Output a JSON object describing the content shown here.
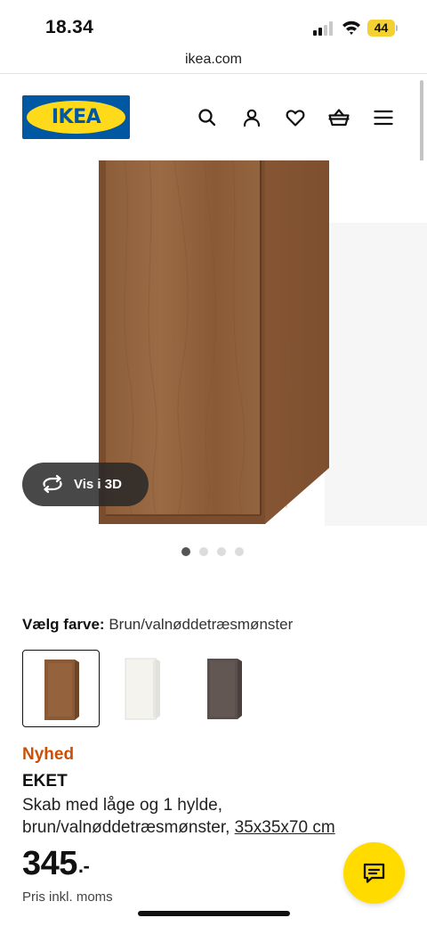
{
  "status_bar": {
    "time": "18.34",
    "battery_level": "44",
    "icons": [
      "signal-icon",
      "wifi-icon",
      "battery-icon"
    ]
  },
  "browser": {
    "url": "ikea.com"
  },
  "header": {
    "logo_text": "IKEA",
    "icons": [
      "search-icon",
      "account-icon",
      "heart-icon",
      "basket-icon",
      "menu-icon"
    ]
  },
  "gallery": {
    "view_3d_label": "Vis i 3D",
    "slide_count": 4,
    "active_slide": 1
  },
  "color_picker": {
    "label": "Vælg farve:",
    "selected_value": "Brun/valnøddetræsmønster",
    "options": [
      {
        "name": "brown-walnut",
        "color": "#8a5a36",
        "selected": true
      },
      {
        "name": "white",
        "color": "#f4f3ee",
        "selected": false
      },
      {
        "name": "dark-grey",
        "color": "#5a4f4c",
        "selected": false
      }
    ]
  },
  "product": {
    "badge": "Nyhed",
    "name": "EKET",
    "description": "Skab med låge og 1 hylde, brun/valnøddetræsmønster,",
    "dimensions": "35x35x70 cm",
    "price": "345",
    "price_suffix": ".-",
    "vat_note": "Pris inkl. moms"
  },
  "colors": {
    "ikea_blue": "#0058a3",
    "ikea_yellow": "#ffda1a",
    "badge_orange": "#ca5008",
    "chat_yellow": "#ffdb00"
  }
}
